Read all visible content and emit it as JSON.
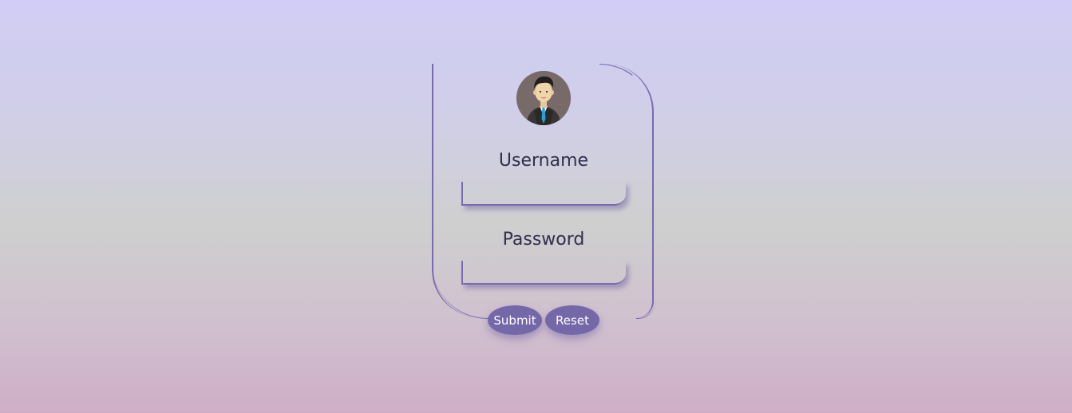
{
  "form": {
    "username_label": "Username",
    "username_value": "",
    "password_label": "Password",
    "password_value": "",
    "submit_label": "Submit",
    "reset_label": "Reset"
  },
  "avatar": {
    "icon": "user-avatar-businessman-icon"
  },
  "colors": {
    "accent": "#7468a8",
    "border": "#7a6ab0",
    "label_text": "#332d4e",
    "avatar_bg": "#776a69",
    "tie": "#2a9fd6"
  }
}
